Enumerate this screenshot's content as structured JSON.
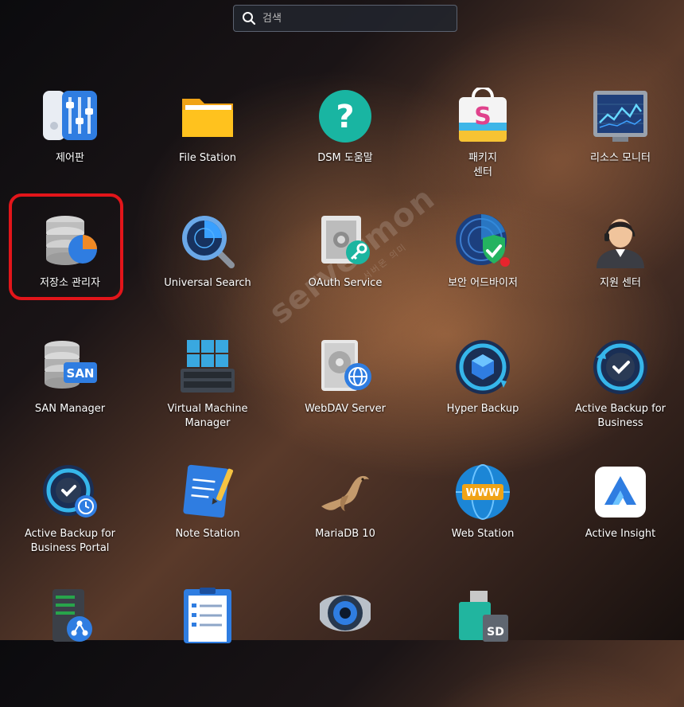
{
  "search": {
    "placeholder": "검색"
  },
  "watermark": {
    "text": "servermon",
    "sub": "서버몬 의미"
  },
  "apps": [
    {
      "label": "제어판",
      "icon": "control-panel-icon"
    },
    {
      "label": "File Station",
      "icon": "folder-icon"
    },
    {
      "label": "DSM 도움말",
      "icon": "help-icon"
    },
    {
      "label": "패키지\n센터",
      "icon": "package-center-icon"
    },
    {
      "label": "리소스 모니터",
      "icon": "resource-monitor-icon"
    },
    {
      "label": "저장소 관리자",
      "icon": "storage-manager-icon",
      "highlighted": true
    },
    {
      "label": "Universal Search",
      "icon": "universal-search-icon"
    },
    {
      "label": "OAuth Service",
      "icon": "oauth-service-icon"
    },
    {
      "label": "보안 어드바이저",
      "icon": "security-advisor-icon"
    },
    {
      "label": "지원 센터",
      "icon": "support-center-icon"
    },
    {
      "label": "SAN Manager",
      "icon": "san-manager-icon"
    },
    {
      "label": "Virtual Machine\nManager",
      "icon": "virtual-machine-manager-icon"
    },
    {
      "label": "WebDAV Server",
      "icon": "webdav-server-icon"
    },
    {
      "label": "Hyper Backup",
      "icon": "hyper-backup-icon"
    },
    {
      "label": "Active Backup for\nBusiness",
      "icon": "active-backup-icon"
    },
    {
      "label": "Active Backup for\nBusiness Portal",
      "icon": "active-backup-portal-icon"
    },
    {
      "label": "Note Station",
      "icon": "note-station-icon"
    },
    {
      "label": "MariaDB 10",
      "icon": "mariadb-icon"
    },
    {
      "label": "Web Station",
      "icon": "web-station-icon"
    },
    {
      "label": "Active Insight",
      "icon": "active-insight-icon"
    },
    {
      "label": "",
      "icon": "network-server-icon"
    },
    {
      "label": "",
      "icon": "clipboard-list-icon"
    },
    {
      "label": "",
      "icon": "surveillance-camera-icon"
    },
    {
      "label": "",
      "icon": "usb-sd-copy-icon"
    }
  ],
  "san_badge": "SAN",
  "www_badge": "WWW",
  "sd_badge": "SD",
  "colors": {
    "highlight": "#e2151a",
    "accent_blue": "#2f7de1"
  }
}
